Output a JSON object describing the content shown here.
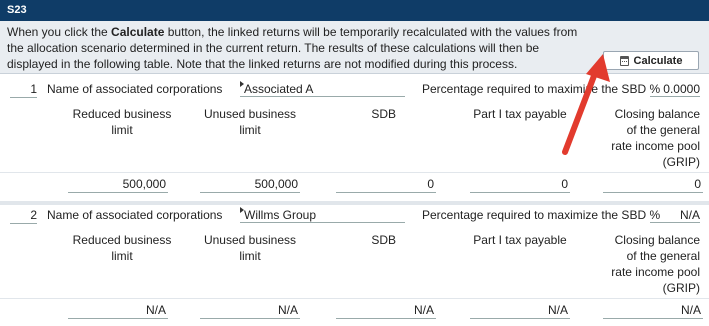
{
  "section": {
    "code": "S23"
  },
  "info": {
    "text_before": "When you click the ",
    "bold": "Calculate",
    "text_after": " button, the linked returns will be temporarily recalculated with the values from the allocation scenario determined in the current return. The results of these calculations will then be displayed in the following table. Note that the linked returns are not modified during this process."
  },
  "calculate_button": {
    "label": "Calculate",
    "icon": "calculator-icon"
  },
  "columns": {
    "reduced": "Reduced business limit",
    "unused": "Unused business limit",
    "sdb": "SDB",
    "part1": "Part I tax payable",
    "grip": "Closing balance of the general rate income pool (GRIP)"
  },
  "corporations": [
    {
      "index": "1",
      "name_label": "Name of associated corporations",
      "name": "Associated A",
      "pct_label": "Percentage required to maximize the SBD %",
      "pct_value": "0.0000",
      "values": {
        "reduced": "500,000",
        "unused": "500,000",
        "sdb": "0",
        "part1": "0",
        "grip": "0"
      }
    },
    {
      "index": "2",
      "name_label": "Name of associated corporations",
      "name": "Willms Group",
      "pct_label": "Percentage required to maximize the SBD %",
      "pct_value": "N/A",
      "values": {
        "reduced": "N/A",
        "unused": "N/A",
        "sdb": "N/A",
        "part1": "N/A",
        "grip": "N/A"
      }
    }
  ],
  "colors": {
    "header": "#0f3c67",
    "info_bg": "#e9edf1",
    "arrow": "#e23b2e"
  }
}
